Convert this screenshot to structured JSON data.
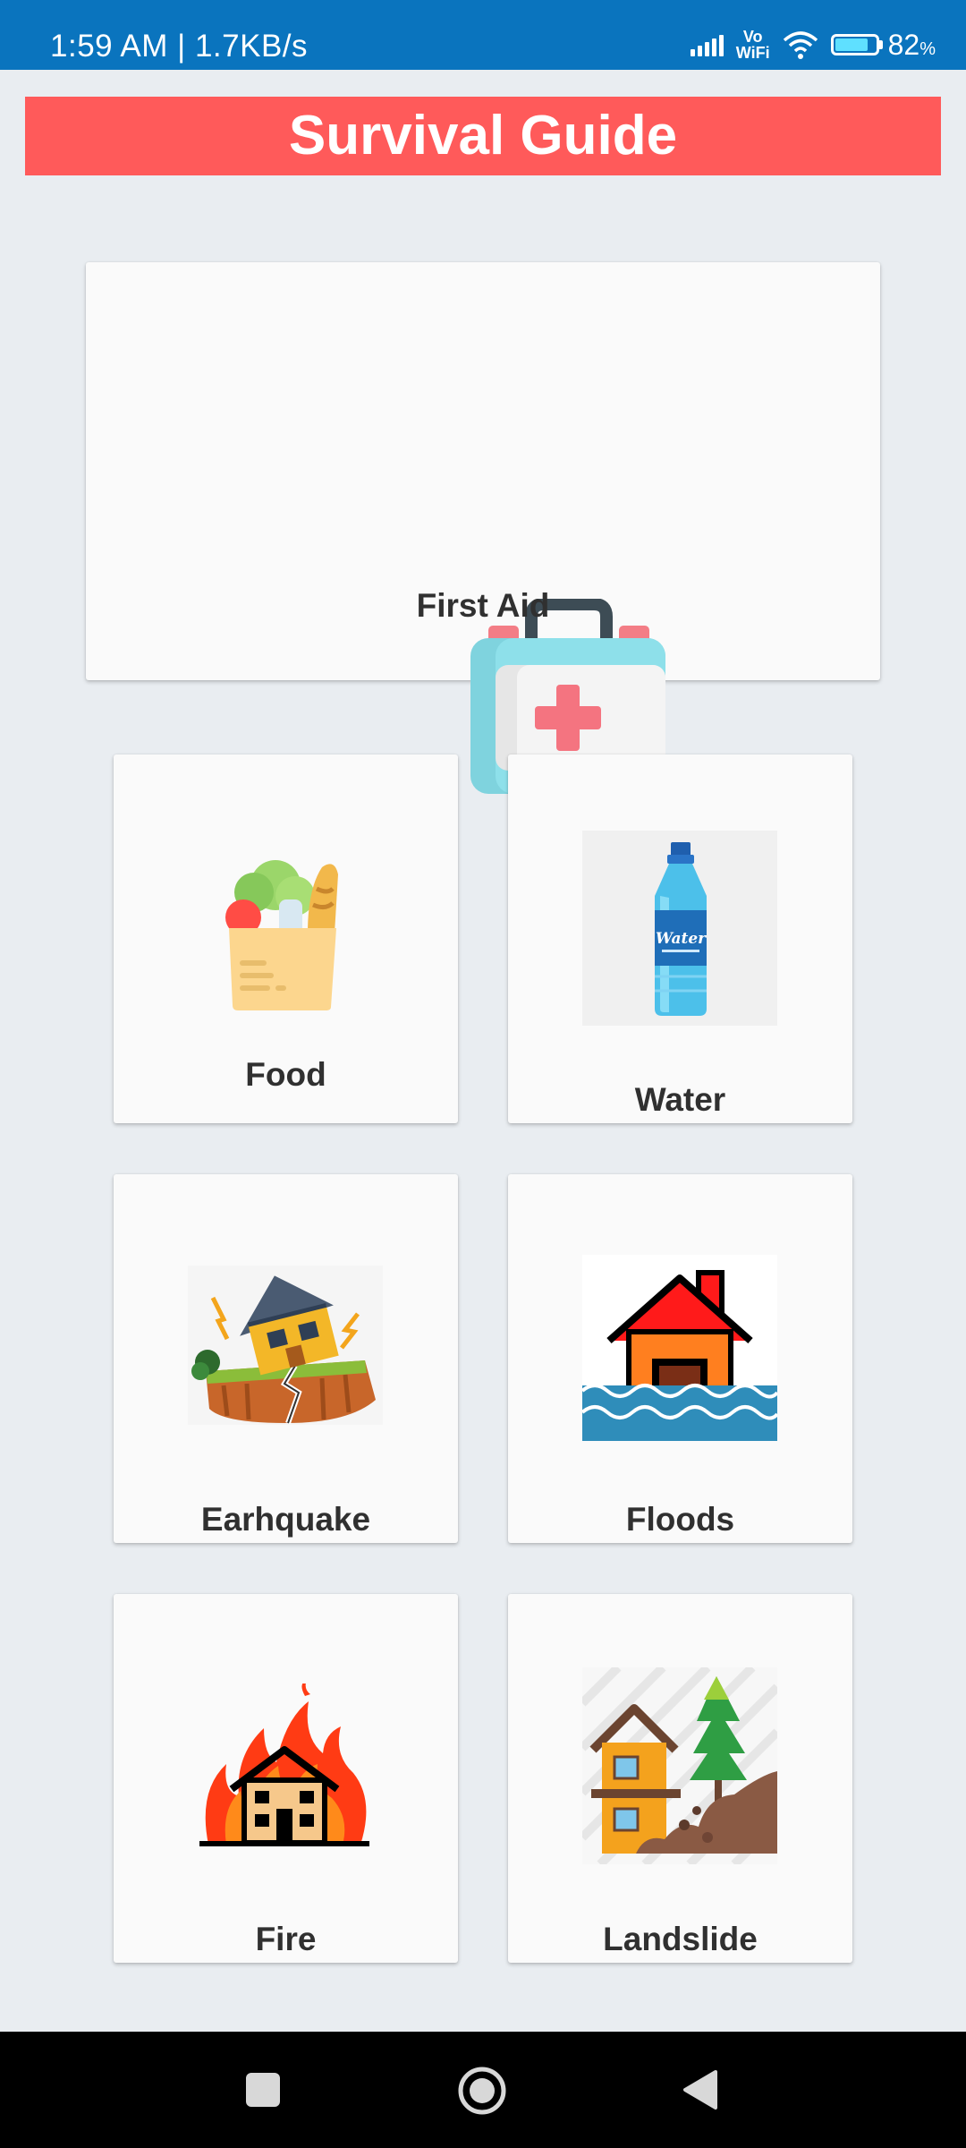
{
  "status_bar": {
    "time_speed": "1:59 AM | 1.7KB/s",
    "vowifi_top": "Vo",
    "vowifi_bottom": "WiFi",
    "battery_percent": "82",
    "battery_percent_sign": "%",
    "battery_level": 0.82
  },
  "header": {
    "title": "Survival Guide",
    "color": "#ff5a5a"
  },
  "cards": {
    "first_aid": {
      "label": "First Aid",
      "icon": "first-aid-kit-icon"
    },
    "food": {
      "label": "Food",
      "icon": "grocery-bag-icon"
    },
    "water": {
      "label": "Water",
      "icon": "water-bottle-icon",
      "bottle_text": "Water"
    },
    "earthquake": {
      "label": "Earhquake",
      "icon": "earthquake-house-icon"
    },
    "floods": {
      "label": "Floods",
      "icon": "flooded-house-icon"
    },
    "fire": {
      "label": "Fire",
      "icon": "burning-house-icon"
    },
    "landslide": {
      "label": "Landslide",
      "icon": "landslide-house-icon"
    }
  },
  "nav_bar": {
    "buttons": [
      "recent-apps",
      "home",
      "back"
    ]
  }
}
